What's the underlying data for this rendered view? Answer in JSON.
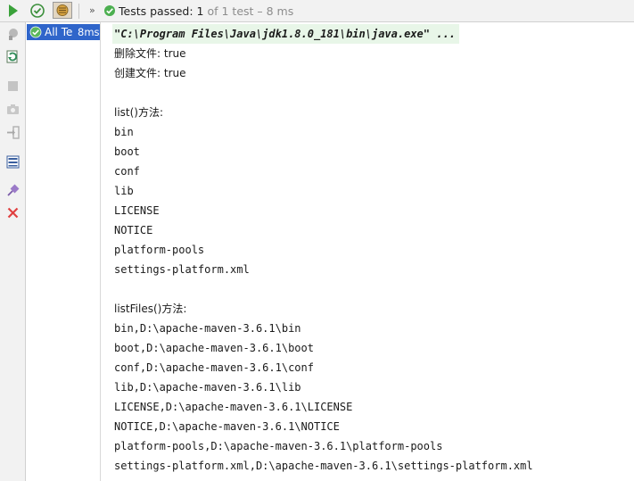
{
  "toolbar": {
    "more_label": "»",
    "status_passed_label": "Tests passed: 1",
    "status_of_label": "of 1 test – 8 ms"
  },
  "tree": {
    "root_label": "All Te",
    "root_time": "8ms"
  },
  "console": {
    "command": "\"C:\\Program Files\\Java\\jdk1.8.0_181\\bin\\java.exe\" ...",
    "lines": [
      "删除文件: true",
      "创建文件: true",
      "",
      "list()方法:",
      "bin",
      "boot",
      "conf",
      "lib",
      "LICENSE",
      "NOTICE",
      "platform-pools",
      "settings-platform.xml",
      "",
      "listFiles()方法:",
      "bin,D:\\apache-maven-3.6.1\\bin",
      "boot,D:\\apache-maven-3.6.1\\boot",
      "conf,D:\\apache-maven-3.6.1\\conf",
      "lib,D:\\apache-maven-3.6.1\\lib",
      "LICENSE,D:\\apache-maven-3.6.1\\LICENSE",
      "NOTICE,D:\\apache-maven-3.6.1\\NOTICE",
      "platform-pools,D:\\apache-maven-3.6.1\\platform-pools",
      "settings-platform.xml,D:\\apache-maven-3.6.1\\settings-platform.xml"
    ]
  },
  "colors": {
    "pass_green": "#4caf50",
    "selection_blue": "#2f65ca",
    "stop_red": "#e04040"
  }
}
